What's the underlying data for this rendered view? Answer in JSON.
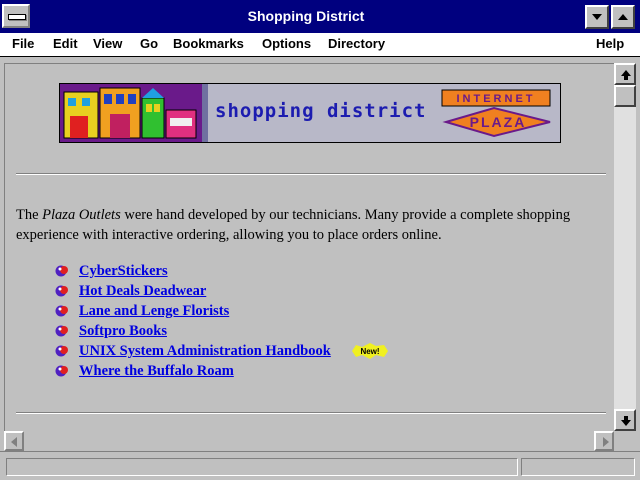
{
  "window": {
    "title": "Shopping District"
  },
  "menu": {
    "file": "File",
    "edit": "Edit",
    "view": "View",
    "go": "Go",
    "bookmarks": "Bookmarks",
    "options": "Options",
    "directory": "Directory",
    "help": "Help"
  },
  "banner": {
    "text": "shopping district",
    "logo_top": "INTERNET",
    "logo_bottom": "PLAZA"
  },
  "intro": {
    "before": "The ",
    "italic": "Plaza Outlets",
    "after": " were hand developed by our technicians. Many provide a complete shopping experience with interactive ordering, allowing you to place orders online."
  },
  "links": [
    "CyberStickers",
    "Hot Deals Deadwear",
    "Lane and Lenge Florists",
    "Softpro Books",
    "UNIX System Administration Handbook",
    "Where the Buffalo Roam"
  ],
  "badge": {
    "new": "New!"
  },
  "colors": {
    "titlebar": "#00007f",
    "link": "#0000e0",
    "banner_text": "#1c1cb0",
    "logo_orange": "#f08020"
  },
  "icons": {
    "bullet": "ball-bullet-icon",
    "scroll_up": "arrow-up-icon",
    "scroll_down": "arrow-down-icon",
    "scroll_left": "arrow-left-icon",
    "scroll_right": "arrow-right-icon"
  }
}
